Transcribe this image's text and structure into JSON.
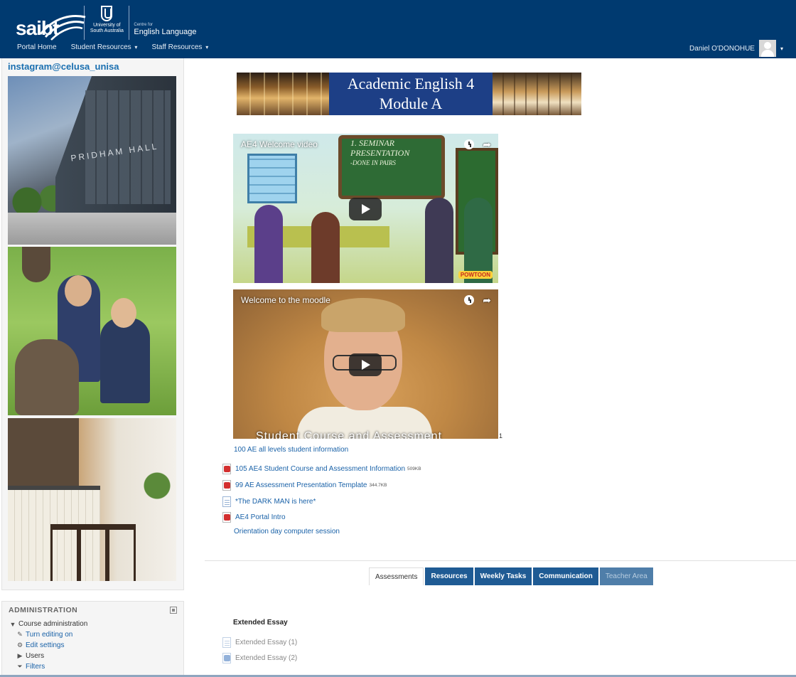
{
  "header": {
    "logo_saibt": "saibt",
    "logo_unisa": "University of South Australia",
    "logo_cel_small": "Centre for",
    "logo_cel_big": "English Language",
    "nav": [
      {
        "label": "Portal Home",
        "has_caret": false
      },
      {
        "label": "Student Resources",
        "has_caret": true
      },
      {
        "label": "Staff Resources",
        "has_caret": true
      }
    ],
    "caret_glyph": "▾",
    "user_name": "Daniel O'DONOHUE",
    "user_caret": "▾",
    "background_color": "#003a70"
  },
  "instagram": {
    "title": "instagram@celusa_unisa",
    "photo_1_sign": "PRIDHAM HALL"
  },
  "administration": {
    "title": "ADMINISTRATION",
    "items": [
      {
        "label": "Course administration",
        "icon": "triangle-down-icon",
        "glyph": "▼",
        "link": false
      },
      {
        "label": "Turn editing on",
        "icon": "pencil-icon",
        "glyph": "✎",
        "link": true
      },
      {
        "label": "Edit settings",
        "icon": "gear-icon",
        "glyph": "⚙",
        "link": true
      },
      {
        "label": "Users",
        "icon": "triangle-right-icon",
        "glyph": "▶",
        "link": false
      },
      {
        "label": "Filters",
        "icon": "filter-icon",
        "glyph": "⏷",
        "link": true
      }
    ]
  },
  "banner": {
    "line1": "Academic English 4",
    "line2": "Module A"
  },
  "videos": [
    {
      "title": "AE4 Welcome video",
      "board_text_1": "1. SEMINAR",
      "board_text_2": "PRESENTATION",
      "board_text_3": "-DONE IN PAIRS",
      "logo": "POWTOON"
    },
    {
      "title": "Welcome to the moodle",
      "caption": "Student Course and Assessment"
    }
  ],
  "share_glyph": "➦",
  "stray_number": "1",
  "resources": {
    "info_link": "100 AE all levels student information",
    "files": [
      {
        "label": "105 AE4 Student Course and Assessment Information",
        "size": "509KB",
        "icon": "pdf-icon"
      },
      {
        "label": "99 AE Assessment Presentation Template",
        "size": "344.7KB",
        "icon": "pdf-icon"
      },
      {
        "label": "*The DARK MAN is here*",
        "size": "",
        "icon": "document-icon"
      },
      {
        "label": "AE4 Portal Intro",
        "size": "",
        "icon": "pdf-icon"
      }
    ],
    "orientation_link": "Orientation day computer session"
  },
  "tabs": [
    {
      "label": "Assessments",
      "state": "active"
    },
    {
      "label": "Resources",
      "state": "normal"
    },
    {
      "label": "Weekly Tasks",
      "state": "normal"
    },
    {
      "label": "Communication",
      "state": "normal"
    },
    {
      "label": "Teacher Area",
      "state": "disabled"
    }
  ],
  "section": {
    "title": "Extended Essay",
    "items": [
      {
        "label": "Extended Essay (1)",
        "icon": "document-icon"
      },
      {
        "label": "Extended Essay (2)",
        "icon": "word-icon"
      }
    ]
  }
}
